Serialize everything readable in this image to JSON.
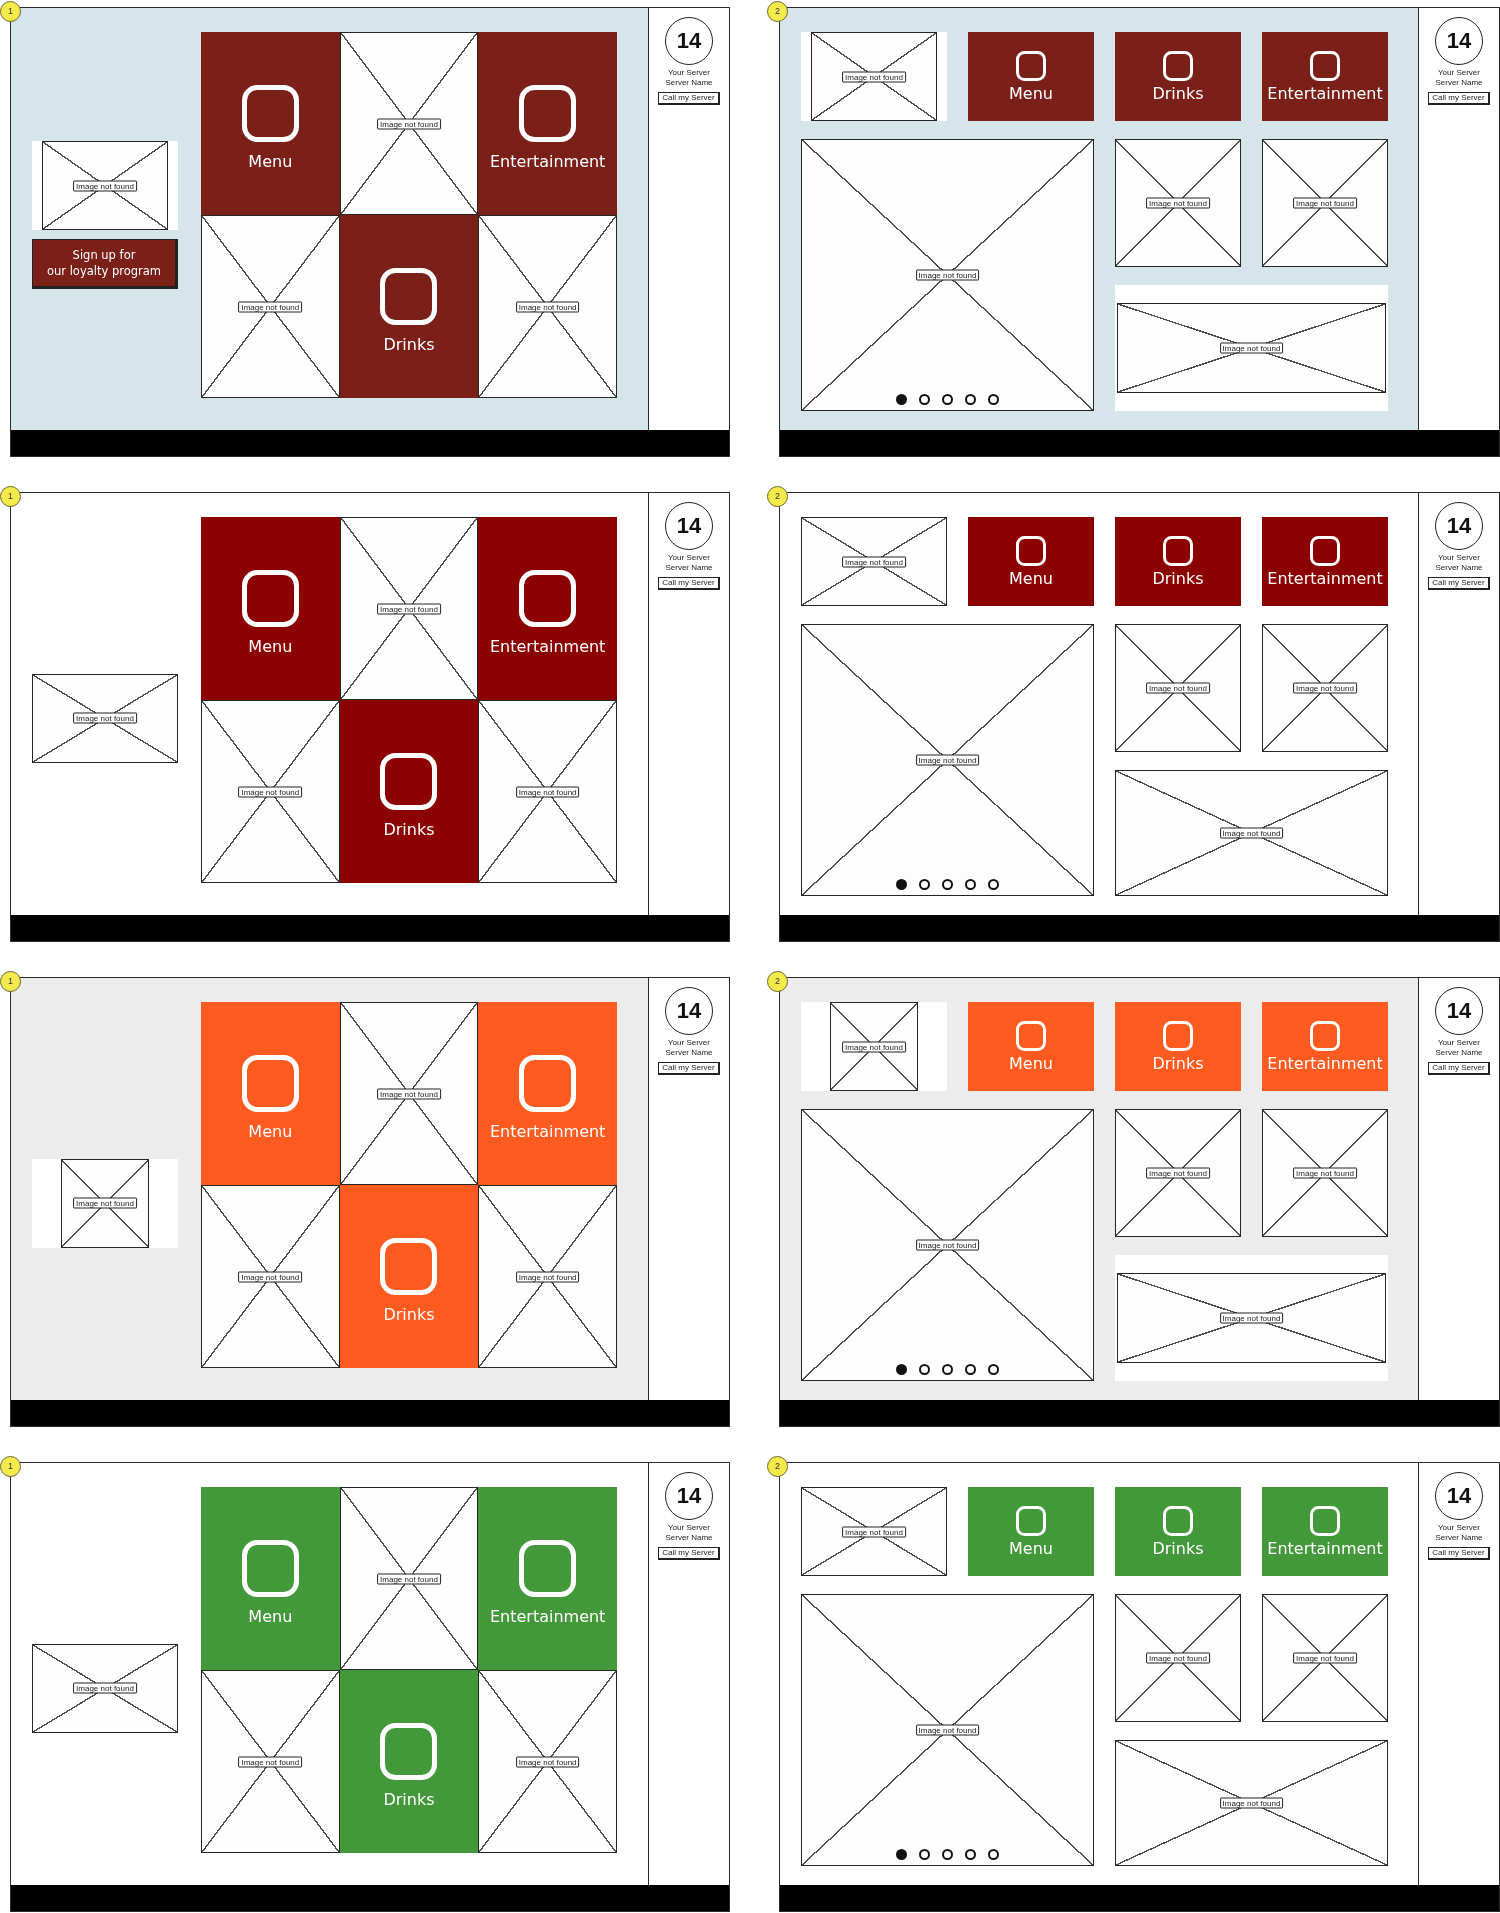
{
  "screens": [
    {
      "kind": "tinted",
      "color": "#7a2019",
      "panels": [
        {
          "kind": "grid",
          "marker": "1",
          "aside": {
            "image": {
              "label": "Image not found",
              "backed": true,
              "kind": "wide"
            },
            "button": "Sign up for\nour loyalty program"
          },
          "cells": [
            {
              "kind": "tile",
              "label": "Menu"
            },
            {
              "kind": "image",
              "label": "Image not found"
            },
            {
              "kind": "tile",
              "label": "Entertainment"
            },
            {
              "kind": "image",
              "label": "Image not found"
            },
            {
              "kind": "tile",
              "label": "Drinks"
            },
            {
              "kind": "image",
              "label": "Image not found"
            }
          ],
          "server": {
            "table": "14",
            "heading": "Your Server",
            "name": "Server Name",
            "button": "Call my Server"
          }
        },
        {
          "kind": "dashboard",
          "marker": "2",
          "logo": {
            "label": "Image not found",
            "backed": true,
            "kind": "wide"
          },
          "tiles": [
            {
              "label": "Menu"
            },
            {
              "label": "Drinks"
            },
            {
              "label": "Entertainment"
            }
          ],
          "hero": {
            "label": "Image not found",
            "dots": [
              {
                "selected": true
              },
              {
                "selected": false
              },
              {
                "selected": false
              },
              {
                "selected": false
              },
              {
                "selected": false
              }
            ]
          },
          "thumbs": [
            {
              "label": "Image not found"
            },
            {
              "label": "Image not found"
            }
          ],
          "banner": {
            "label": "Image not found",
            "backed": true
          },
          "server": {
            "table": "14",
            "heading": "Your Server",
            "name": "Server Name",
            "button": "Call my Server"
          }
        }
      ]
    },
    {
      "kind": "plain",
      "color": "#8c0101",
      "panels": [
        {
          "kind": "grid",
          "marker": "1",
          "aside": {
            "image": {
              "label": "Image not found",
              "backed": false,
              "kind": "wide"
            }
          },
          "cells": [
            {
              "kind": "tile",
              "label": "Menu"
            },
            {
              "kind": "image",
              "label": "Image not found"
            },
            {
              "kind": "tile",
              "label": "Entertainment"
            },
            {
              "kind": "image",
              "label": "Image not found"
            },
            {
              "kind": "tile",
              "label": "Drinks"
            },
            {
              "kind": "image",
              "label": "Image not found"
            }
          ],
          "server": {
            "table": "14",
            "heading": "Your Server",
            "name": "Server Name",
            "button": "Call my Server"
          }
        },
        {
          "kind": "dashboard",
          "marker": "2",
          "logo": {
            "label": "Image not found",
            "backed": false,
            "kind": "wide"
          },
          "tiles": [
            {
              "label": "Menu"
            },
            {
              "label": "Drinks"
            },
            {
              "label": "Entertainment"
            }
          ],
          "hero": {
            "label": "Image not found",
            "dots": [
              {
                "selected": true
              },
              {
                "selected": false
              },
              {
                "selected": false
              },
              {
                "selected": false
              },
              {
                "selected": false
              }
            ]
          },
          "thumbs": [
            {
              "label": "Image not found"
            },
            {
              "label": "Image not found"
            }
          ],
          "banner": {
            "label": "Image not found",
            "backed": false
          },
          "server": {
            "table": "14",
            "heading": "Your Server",
            "name": "Server Name",
            "button": "Call my Server"
          }
        }
      ]
    },
    {
      "kind": "grey",
      "color": "#ff5a1f",
      "panels": [
        {
          "kind": "grid",
          "marker": "1",
          "aside": {
            "image": {
              "label": "Image not found",
              "backed": true,
              "kind": "square"
            }
          },
          "cells": [
            {
              "kind": "tile",
              "label": "Menu"
            },
            {
              "kind": "image",
              "label": "Image not found"
            },
            {
              "kind": "tile",
              "label": "Entertainment"
            },
            {
              "kind": "image",
              "label": "Image not found"
            },
            {
              "kind": "tile",
              "label": "Drinks"
            },
            {
              "kind": "image",
              "label": "Image not found"
            }
          ],
          "server": {
            "table": "14",
            "heading": "Your Server",
            "name": "Server Name",
            "button": "Call my Server"
          }
        },
        {
          "kind": "dashboard",
          "marker": "2",
          "logo": {
            "label": "Image not found",
            "backed": true,
            "kind": "square"
          },
          "tiles": [
            {
              "label": "Menu"
            },
            {
              "label": "Drinks"
            },
            {
              "label": "Entertainment"
            }
          ],
          "hero": {
            "label": "Image not found",
            "dots": [
              {
                "selected": true
              },
              {
                "selected": false
              },
              {
                "selected": false
              },
              {
                "selected": false
              },
              {
                "selected": false
              }
            ]
          },
          "thumbs": [
            {
              "label": "Image not found"
            },
            {
              "label": "Image not found"
            }
          ],
          "banner": {
            "label": "Image not found",
            "backed": true
          },
          "server": {
            "table": "14",
            "heading": "Your Server",
            "name": "Server Name",
            "button": "Call my Server"
          }
        }
      ]
    },
    {
      "kind": "plain",
      "color": "#43983a",
      "panels": [
        {
          "kind": "grid",
          "marker": "1",
          "aside": {
            "image": {
              "label": "Image not found",
              "backed": false,
              "kind": "wide"
            }
          },
          "cells": [
            {
              "kind": "tile",
              "label": "Menu"
            },
            {
              "kind": "image",
              "label": "Image not found"
            },
            {
              "kind": "tile",
              "label": "Entertainment"
            },
            {
              "kind": "image",
              "label": "Image not found"
            },
            {
              "kind": "tile",
              "label": "Drinks"
            },
            {
              "kind": "image",
              "label": "Image not found"
            }
          ],
          "server": {
            "table": "14",
            "heading": "Your Server",
            "name": "Server Name",
            "button": "Call my Server"
          }
        },
        {
          "kind": "dashboard",
          "marker": "2",
          "logo": {
            "label": "Image not found",
            "backed": false,
            "kind": "wide"
          },
          "tiles": [
            {
              "label": "Menu"
            },
            {
              "label": "Drinks"
            },
            {
              "label": "Entertainment"
            }
          ],
          "hero": {
            "label": "Image not found",
            "dots": [
              {
                "selected": true
              },
              {
                "selected": false
              },
              {
                "selected": false
              },
              {
                "selected": false
              },
              {
                "selected": false
              }
            ]
          },
          "thumbs": [
            {
              "label": "Image not found"
            },
            {
              "label": "Image not found"
            }
          ],
          "banner": {
            "label": "Image not found",
            "backed": false
          },
          "server": {
            "table": "14",
            "heading": "Your Server",
            "name": "Server Name",
            "button": "Call my Server"
          }
        }
      ]
    }
  ]
}
